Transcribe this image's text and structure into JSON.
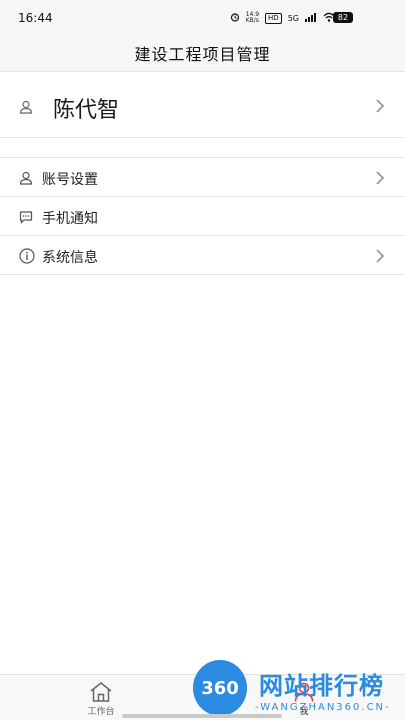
{
  "status_bar": {
    "time": "16:44",
    "net_speed_value": "14.9",
    "net_speed_unit": "KB/s",
    "hd_label": "HD",
    "network": "5G",
    "battery": "82"
  },
  "header": {
    "title": "建设工程项目管理"
  },
  "profile": {
    "name": "陈代智",
    "icon": "user-icon"
  },
  "menu": [
    {
      "label": "账号设置",
      "icon": "user-icon",
      "has_chevron": true
    },
    {
      "label": "手机通知",
      "icon": "message-icon",
      "has_chevron": false
    },
    {
      "label": "系统信息",
      "icon": "info-icon",
      "has_chevron": true
    }
  ],
  "tabbar": {
    "tabs": [
      {
        "label": "工作台",
        "icon": "home-icon"
      },
      {
        "label": "我",
        "icon": "user-icon"
      }
    ]
  },
  "watermark": {
    "logo_text": "360",
    "title": "网站排行榜",
    "subtitle": "-WANGZHAN360.CN-"
  },
  "colors": {
    "accent": "#2a8be0",
    "header_bg": "#f6f6f6",
    "divider": "#e6e6e6"
  }
}
